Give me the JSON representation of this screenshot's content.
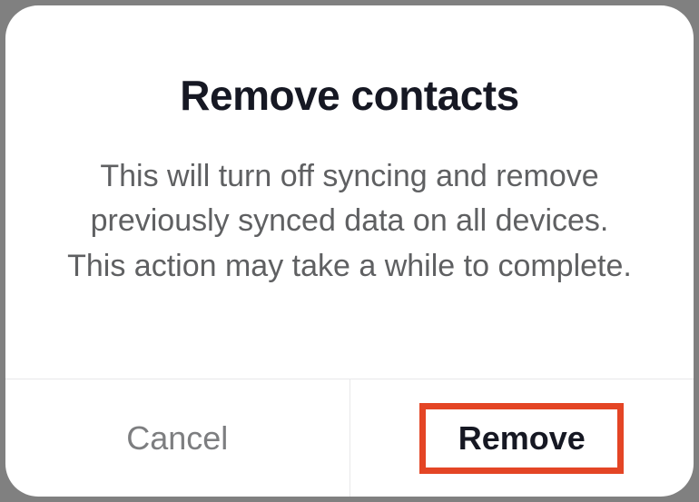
{
  "dialog": {
    "title": "Remove contacts",
    "message": "This will turn off syncing and remove previously synced data on all devices. This action may take a while to complete.",
    "cancel_label": "Cancel",
    "confirm_label": "Remove"
  }
}
